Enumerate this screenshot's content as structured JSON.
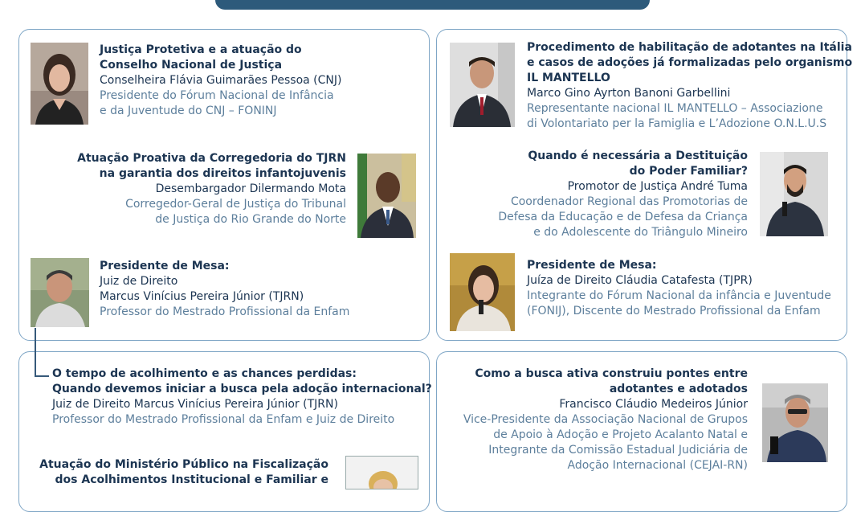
{
  "tl": {
    "b1": {
      "title": [
        "Justiça Protetiva e a atuação do",
        "Conselho Nacional de Justiça"
      ],
      "name": "Conselheira Flávia Guimarães Pessoa (CNJ)",
      "role": [
        "Presidente do Fórum Nacional de Infância",
        "e da Juventude do CNJ – FONINJ"
      ]
    },
    "b2": {
      "title": [
        "Atuação Proativa da Corregedoria do TJRN",
        "na garantia dos direitos infantojuvenis"
      ],
      "name": "Desembargador Dilermando Mota",
      "role": [
        "Corregedor-Geral de Justiça do Tribunal",
        "de Justiça do Rio Grande do Norte"
      ]
    },
    "b3": {
      "title": "Presidente de Mesa:",
      "name": [
        "Juiz de Direito",
        "Marcus Vinícius Pereira Júnior (TJRN)"
      ],
      "role": "Professor do Mestrado Profissional da Enfam"
    }
  },
  "tr": {
    "b1": {
      "title": [
        "Procedimento de habilitação de adotantes na Itália",
        "e casos de adoções já formalizadas pelo organismo",
        "IL MANTELLO"
      ],
      "name": "Marco Gino Ayrton Banoni Garbellini",
      "role": [
        "Representante nacional IL MANTELLO – Associazione",
        "di Volontariato per la Famiglia e L’Adozione O.N.L.U.S"
      ]
    },
    "b2": {
      "title": [
        "Quando é necessária a Destituição",
        "do Poder Familiar?"
      ],
      "name": "Promotor de Justiça André Tuma",
      "role": [
        "Coordenador Regional das Promotorias de",
        "Defesa da Educação e de Defesa da Criança",
        "e do Adolescente do Triângulo Mineiro"
      ]
    },
    "b3": {
      "title": "Presidente de Mesa:",
      "name": "Juíza de Direito Cláudia Catafesta (TJPR)",
      "role": [
        "Integrante do Fórum Nacional da infância e Juventude",
        "(FONIJ), Discente do Mestrado Profissional da Enfam"
      ]
    }
  },
  "bl": {
    "b1": {
      "title": [
        "O tempo de acolhimento e as chances perdidas:",
        "Quando devemos iniciar a busca pela adoção internacional?"
      ],
      "name": "Juiz de Direito Marcus Vinícius Pereira Júnior (TJRN)",
      "role": "Professor do Mestrado Profissional da Enfam e Juiz de Direito"
    },
    "b2": {
      "title": [
        "Atuação do Ministério Público na Fiscalização",
        "dos Acolhimentos Institucional e Familiar e"
      ]
    }
  },
  "br": {
    "b1": {
      "title": [
        "Como a busca ativa construiu pontes entre",
        "adotantes e adotados"
      ],
      "name": "Francisco Cláudio Medeiros Júnior",
      "role": [
        "Vice-Presidente da Associação Nacional de Grupos",
        "de Apoio à Adoção e Projeto Acalanto Natal e",
        "Integrante da Comissão Estadual Judiciária de",
        "Adoção Internacional (CEJAI-RN)"
      ]
    }
  }
}
